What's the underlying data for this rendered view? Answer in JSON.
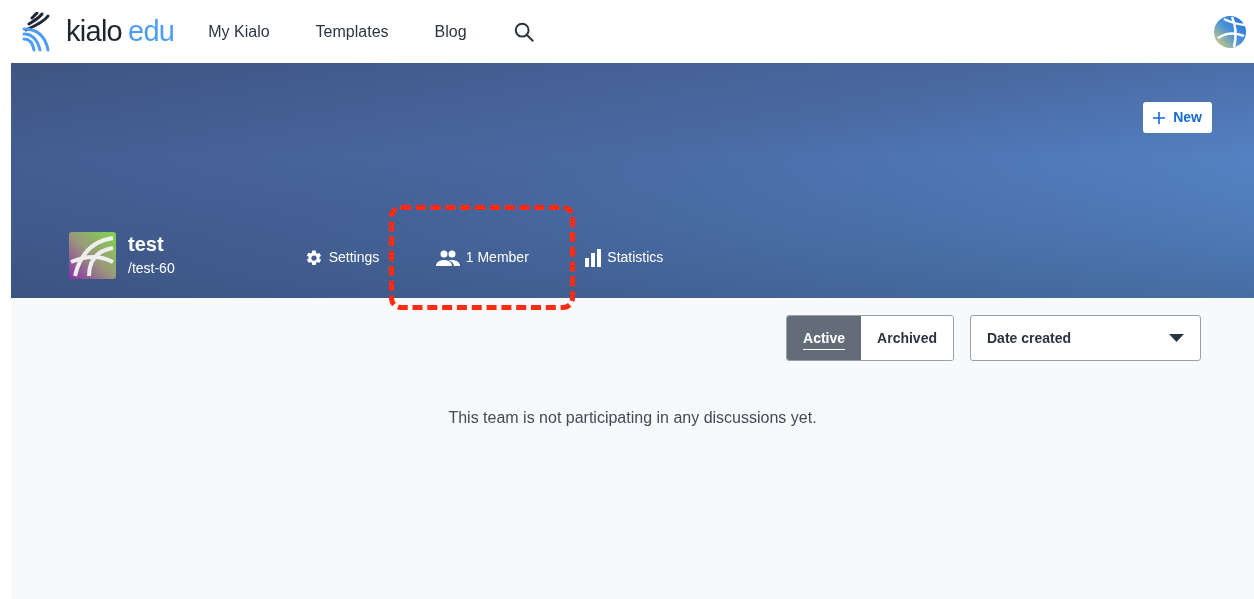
{
  "header": {
    "logo_main": "kialo",
    "logo_sub": "edu",
    "nav": [
      "My Kialo",
      "Templates",
      "Blog"
    ]
  },
  "banner": {
    "new_button": "New",
    "team": {
      "name": "test",
      "slug": "/test-60"
    },
    "links": [
      {
        "kind": "settings",
        "label": "Settings",
        "highlighted": false
      },
      {
        "kind": "members",
        "label": "1 Member",
        "highlighted": true
      },
      {
        "kind": "statistics",
        "label": "Statistics",
        "highlighted": false
      }
    ]
  },
  "filter_tabs": [
    {
      "label": "Active",
      "selected": true
    },
    {
      "label": "Archived",
      "selected": false
    }
  ],
  "sort_dropdown": {
    "value": "Date created"
  },
  "empty_message": "This team is not participating in any discussions yet."
}
